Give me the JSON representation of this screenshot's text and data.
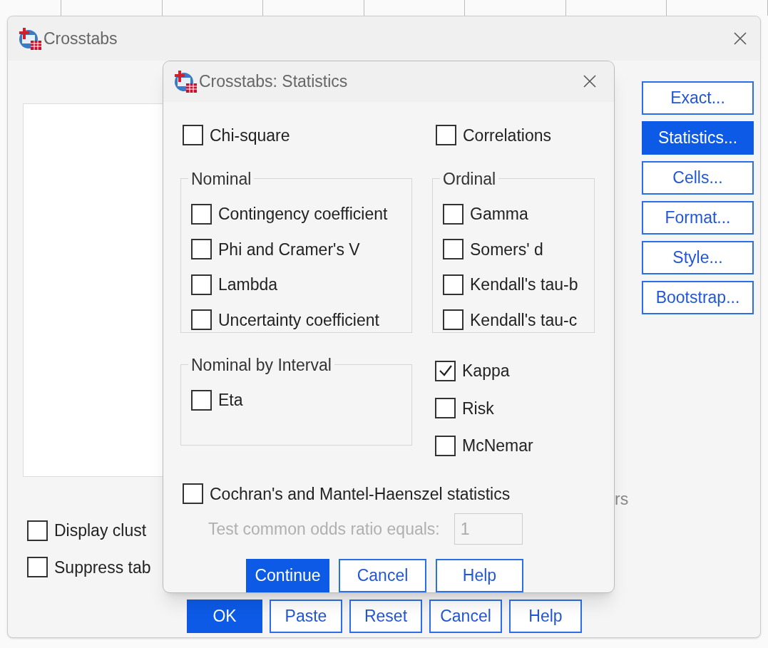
{
  "main_window": {
    "title": "Crosstabs",
    "side_buttons": [
      {
        "label": "Exact...",
        "selected": false
      },
      {
        "label": "Statistics...",
        "selected": true
      },
      {
        "label": "Cells...",
        "selected": false
      },
      {
        "label": "Format...",
        "selected": false
      },
      {
        "label": "Style...",
        "selected": false
      },
      {
        "label": "Bootstrap...",
        "selected": false
      }
    ],
    "options": [
      {
        "label": "Display clust",
        "checked": false
      },
      {
        "label": "Suppress tab",
        "checked": false
      }
    ],
    "partial_label": "rs",
    "buttons": [
      {
        "label": "OK",
        "default": true
      },
      {
        "label": "Paste",
        "default": false
      },
      {
        "label": "Reset",
        "default": false
      },
      {
        "label": "Cancel",
        "default": false
      },
      {
        "label": "Help",
        "default": false
      }
    ]
  },
  "dialog": {
    "title": "Crosstabs: Statistics",
    "chi_square": {
      "label": "Chi-square",
      "checked": false
    },
    "correlations": {
      "label": "Correlations",
      "checked": false
    },
    "nominal": {
      "title": "Nominal",
      "items": [
        {
          "label": "Contingency coefficient",
          "checked": false
        },
        {
          "label": "Phi and Cramer's V",
          "checked": false
        },
        {
          "label": "Lambda",
          "checked": false
        },
        {
          "label": "Uncertainty coefficient",
          "checked": false
        }
      ]
    },
    "ordinal": {
      "title": "Ordinal",
      "items": [
        {
          "label": "Gamma",
          "checked": false
        },
        {
          "label": "Somers' d",
          "checked": false
        },
        {
          "label": "Kendall's tau-b",
          "checked": false
        },
        {
          "label": "Kendall's tau-c",
          "checked": false
        }
      ]
    },
    "nominal_by_interval": {
      "title": "Nominal by Interval",
      "items": [
        {
          "label": "Eta",
          "checked": false
        }
      ]
    },
    "extra": [
      {
        "label": "Kappa",
        "checked": true
      },
      {
        "label": "Risk",
        "checked": false
      },
      {
        "label": "McNemar",
        "checked": false
      }
    ],
    "cochran": {
      "label": "Cochran's and Mantel-Haenszel statistics",
      "checked": false
    },
    "odds_ratio": {
      "label": "Test common odds ratio equals:",
      "value": "1",
      "disabled": true
    },
    "buttons": [
      {
        "label": "Continue",
        "default": true
      },
      {
        "label": "Cancel",
        "default": false
      },
      {
        "label": "Help",
        "default": false
      }
    ]
  }
}
